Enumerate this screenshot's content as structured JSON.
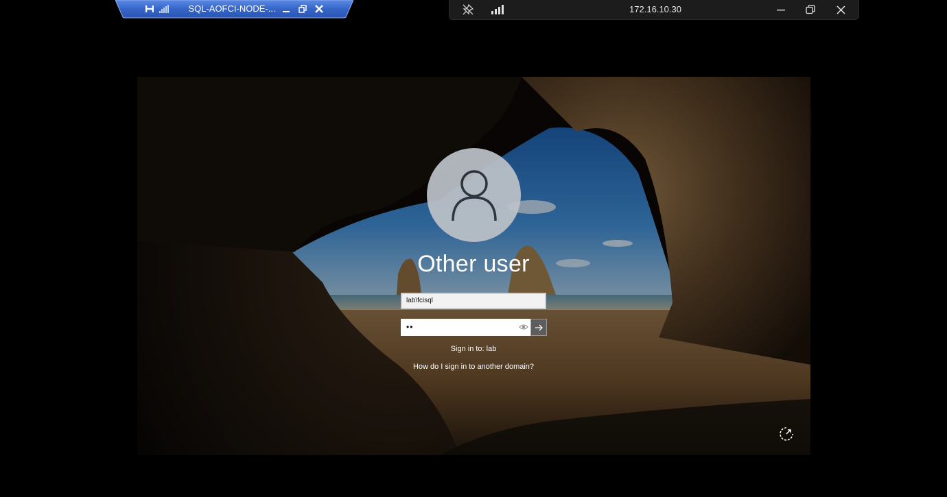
{
  "outer_bar": {
    "title": "172.16.10.30",
    "icons": [
      "unpin-icon",
      "signal-icon",
      "minimize-icon",
      "restore-icon",
      "close-icon"
    ]
  },
  "inner_bar": {
    "title": "SQL-AOFCI-NODE-...",
    "icons": [
      "pin-icon",
      "signal-icon",
      "minimize-icon",
      "restore-icon",
      "close-icon"
    ]
  },
  "login": {
    "user_name": "Other user",
    "username_value": "lab\\fcisql",
    "password_mask": "••",
    "signin_to": "Sign in to: lab",
    "other_domain_link": "How do I sign in to another domain?"
  },
  "colors": {
    "inner_bar_blue": "#3d6fd1",
    "outer_bar": "#1c1c1c",
    "submit_button": "#5d5d5d"
  }
}
